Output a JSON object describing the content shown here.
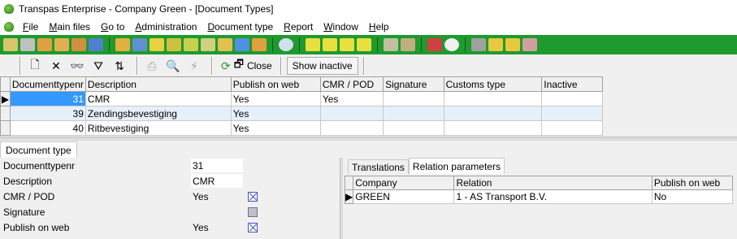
{
  "window": {
    "title": "Transpas Enterprise - Company Green - [Document Types]"
  },
  "menu": {
    "items": [
      "File",
      "Main files",
      "Go to",
      "Administration",
      "Document type",
      "Report",
      "Window",
      "Help"
    ]
  },
  "colors": {
    "toolbar_green": "#1f9a2e",
    "selection_blue": "#3399ff",
    "alt_row": "#e6f0fb",
    "checkbox_blue": "#4050c0"
  },
  "toolbar": {
    "close_label": "Close",
    "show_inactive_label": "Show inactive"
  },
  "grid": {
    "columns": [
      "Documenttypenr",
      "Description",
      "Publish on web",
      "CMR / POD",
      "Signature",
      "Customs type",
      "Inactive"
    ],
    "rows": [
      {
        "nr": "31",
        "description": "CMR",
        "publish": "Yes",
        "cmr": "Yes",
        "signature": "",
        "customs": "",
        "inactive": ""
      },
      {
        "nr": "39",
        "description": "Zendingsbevestiging",
        "publish": "Yes",
        "cmr": "",
        "signature": "",
        "customs": "",
        "inactive": ""
      },
      {
        "nr": "40",
        "description": "Ritbevestiging",
        "publish": "Yes",
        "cmr": "",
        "signature": "",
        "customs": "",
        "inactive": ""
      }
    ]
  },
  "detail": {
    "tab_label": "Document type",
    "fields": [
      {
        "label": "Documenttypenr",
        "value": "31",
        "checkbox": ""
      },
      {
        "label": "Description",
        "value": "CMR",
        "checkbox": ""
      },
      {
        "label": "CMR / POD",
        "value": "Yes",
        "checkbox": "checked"
      },
      {
        "label": "Signature",
        "value": "",
        "checkbox": "grey"
      },
      {
        "label": "Publish on web",
        "value": "Yes",
        "checkbox": "checked"
      }
    ]
  },
  "relations": {
    "tabs": [
      "Translations",
      "Relation parameters"
    ],
    "columns": [
      "Company",
      "Relation",
      "Publish on web"
    ],
    "rows": [
      {
        "company": "GREEN",
        "relation": "1 - AS Transport B.V.",
        "publish": "No"
      }
    ]
  }
}
